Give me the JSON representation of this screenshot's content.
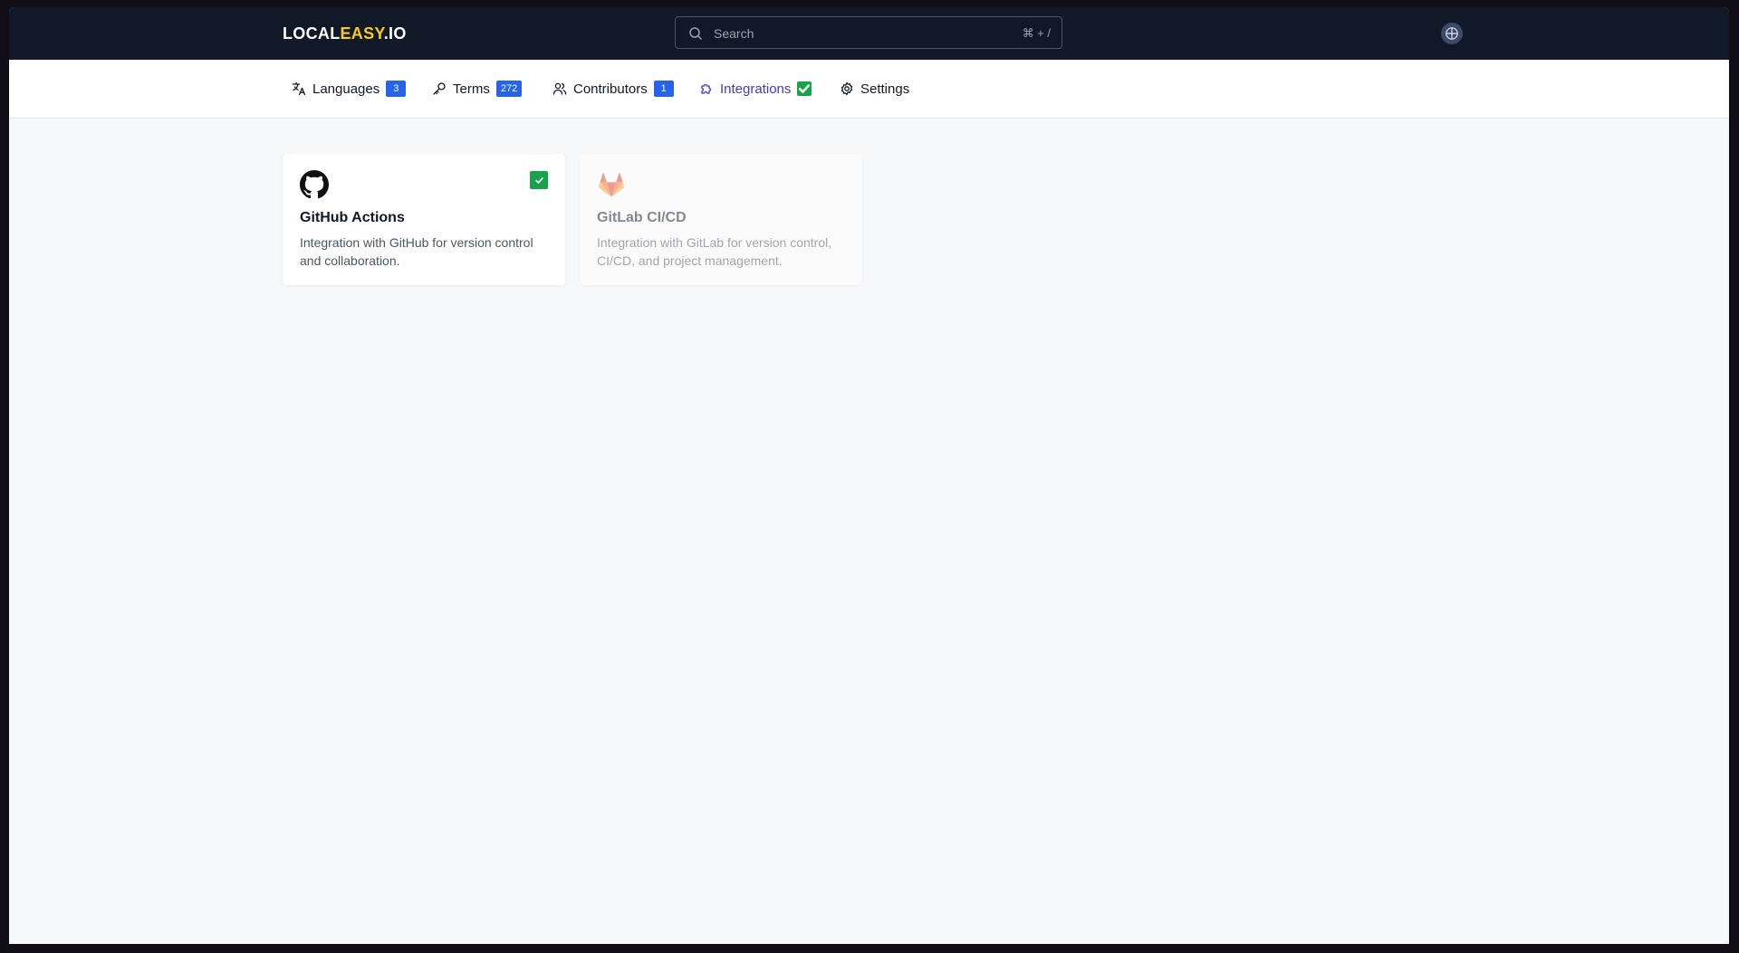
{
  "brand": {
    "part1": "LOCAL",
    "part2": "EASY",
    "part3": ".IO"
  },
  "search": {
    "placeholder": "Search",
    "shortcut": "⌘ + /"
  },
  "header": {
    "language_icon": "globe-icon"
  },
  "tabs": [
    {
      "label": "Languages",
      "badge": "3",
      "icon": "translate-icon"
    },
    {
      "label": "Terms",
      "badge": "272",
      "icon": "key-icon"
    },
    {
      "label": "Contributors",
      "badge": "1",
      "icon": "users-icon"
    },
    {
      "label": "Integrations",
      "badge": "check",
      "icon": "puzzle-icon",
      "active": true
    },
    {
      "label": "Settings",
      "icon": "gear-icon"
    }
  ],
  "integrations": [
    {
      "name": "GitHub Actions",
      "description": "Integration with GitHub for version control and collaboration.",
      "icon": "github-icon",
      "enabled": true
    },
    {
      "name": "GitLab CI/CD",
      "description": "Integration with GitLab for version control, CI/CD, and project management.",
      "icon": "gitlab-icon",
      "enabled": false
    }
  ],
  "colors": {
    "topbar": "#111827",
    "accent": "#facc15",
    "active_tab": "#4338ca",
    "badge": "#2563eb",
    "success": "#16a34a"
  }
}
